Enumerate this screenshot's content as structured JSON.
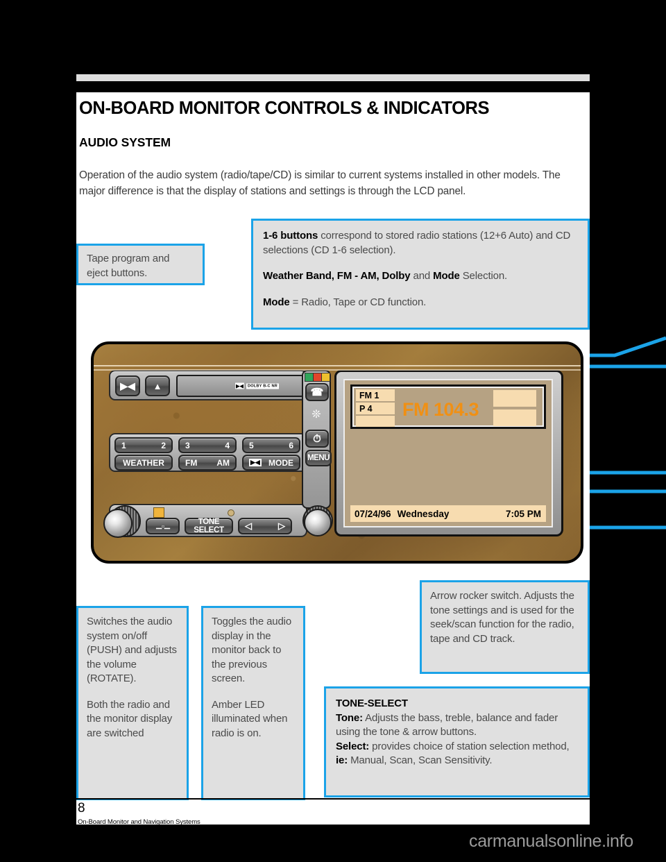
{
  "page": {
    "title": "ON-BOARD MONITOR CONTROLS & INDICATORS",
    "section_heading": "AUDIO SYSTEM",
    "intro_paragraph": "Operation of the audio system (radio/tape/CD) is similar to current systems installed in other models. The major difference is that the display of stations and settings is through the LCD panel.",
    "page_number": "8",
    "footer_text": "On-Board Monitor and Navigation Systems",
    "watermark": "carmanualsonline.info"
  },
  "colors": {
    "accent_blue": "#1ba3e8",
    "callout_fill": "#e0e0e0",
    "lcd_orange": "#f09014",
    "lcd_background": "#b6a283",
    "lcd_tag": "#f7dcb0",
    "led_amber": "#f0b43c",
    "wood_trim": "#8d6a33"
  },
  "callouts": {
    "tape": {
      "name": "tape-program-callout",
      "lines": [
        "Tape program and",
        "eject buttons."
      ]
    },
    "buttons": {
      "name": "buttons-callout",
      "p1_bold": "1-6 buttons",
      "p1_rest": " correspond to stored radio stations (12+6 Auto) and CD selections (CD 1-6 selection).",
      "p2_bold_a": "Weather Band, FM - AM, Dolby",
      "p2_mid": " and ",
      "p2_bold_b": "Mode",
      "p2_rest": " Selection.",
      "p3_bold": "Mode",
      "p3_rest": " = Radio, Tape or CD function."
    },
    "volume": {
      "name": "volume-knob-callout",
      "p1": "Switches the audio system on/off (PUSH) and adjusts the volume (ROTATE).",
      "p2": "Both the radio and the monitor display are switched"
    },
    "toggle": {
      "name": "display-toggle-callout",
      "p1": "Toggles the audio display in the monitor back to the previous screen.",
      "p2": "Amber LED illuminated when radio is on."
    },
    "arrow": {
      "name": "arrow-rocker-callout",
      "text": "Arrow rocker switch. Adjusts the tone settings and is used for the seek/scan function for the radio, tape and CD track."
    },
    "tone_select": {
      "name": "tone-select-callout",
      "title": "TONE-SELECT",
      "tone_bold": "Tone:",
      "tone_rest": " Adjusts the bass, treble, balance and fader using the tone & arrow buttons.",
      "select_bold": "Select:",
      "select_rest": " provides choice of station selection method, ",
      "ie_bold": "ie:",
      "ie_rest": " Manual, Scan, Scan Sensitivity."
    }
  },
  "radio": {
    "tape_row": {
      "program_icon": "tape-program-icon",
      "eject_icon": "eject-icon",
      "dolby_label": "DOLBY B-C NR",
      "dolby_glyph": "▶◀"
    },
    "preset_buttons": [
      {
        "left": "1",
        "right": "2"
      },
      {
        "left": "3",
        "right": "4"
      },
      {
        "left": "5",
        "right": "6"
      }
    ],
    "function_buttons": [
      {
        "label": "WEATHER",
        "align": "center"
      },
      {
        "left": "FM",
        "right": "AM"
      },
      {
        "left": "",
        "right": "MODE",
        "icon": "dolby-icon"
      }
    ],
    "bottom_row": {
      "volume_knob": "volume-knob",
      "display_toggle": "display-toggle-button",
      "led": "amber-led",
      "pin_hole": "reset-pin-hole",
      "tone_select_label": "TONE SELECT",
      "arrow_left": "◁",
      "arrow_right": "▷"
    },
    "side_column": {
      "indicator_squares": [
        "#2fa55a",
        "#e0452a",
        "#edc02e"
      ],
      "phone_icon": "phone-icon",
      "fan_icon": "fan-icon",
      "clock_icon": "clock-icon",
      "menu_label": "MENU",
      "knob": "monitor-knob"
    },
    "lcd": {
      "band": "FM 1",
      "preset": "P 4",
      "frequency": "FM 104.3",
      "status_date": "07/24/96",
      "status_day": "Wednesday",
      "status_time": "7:05 PM"
    }
  }
}
